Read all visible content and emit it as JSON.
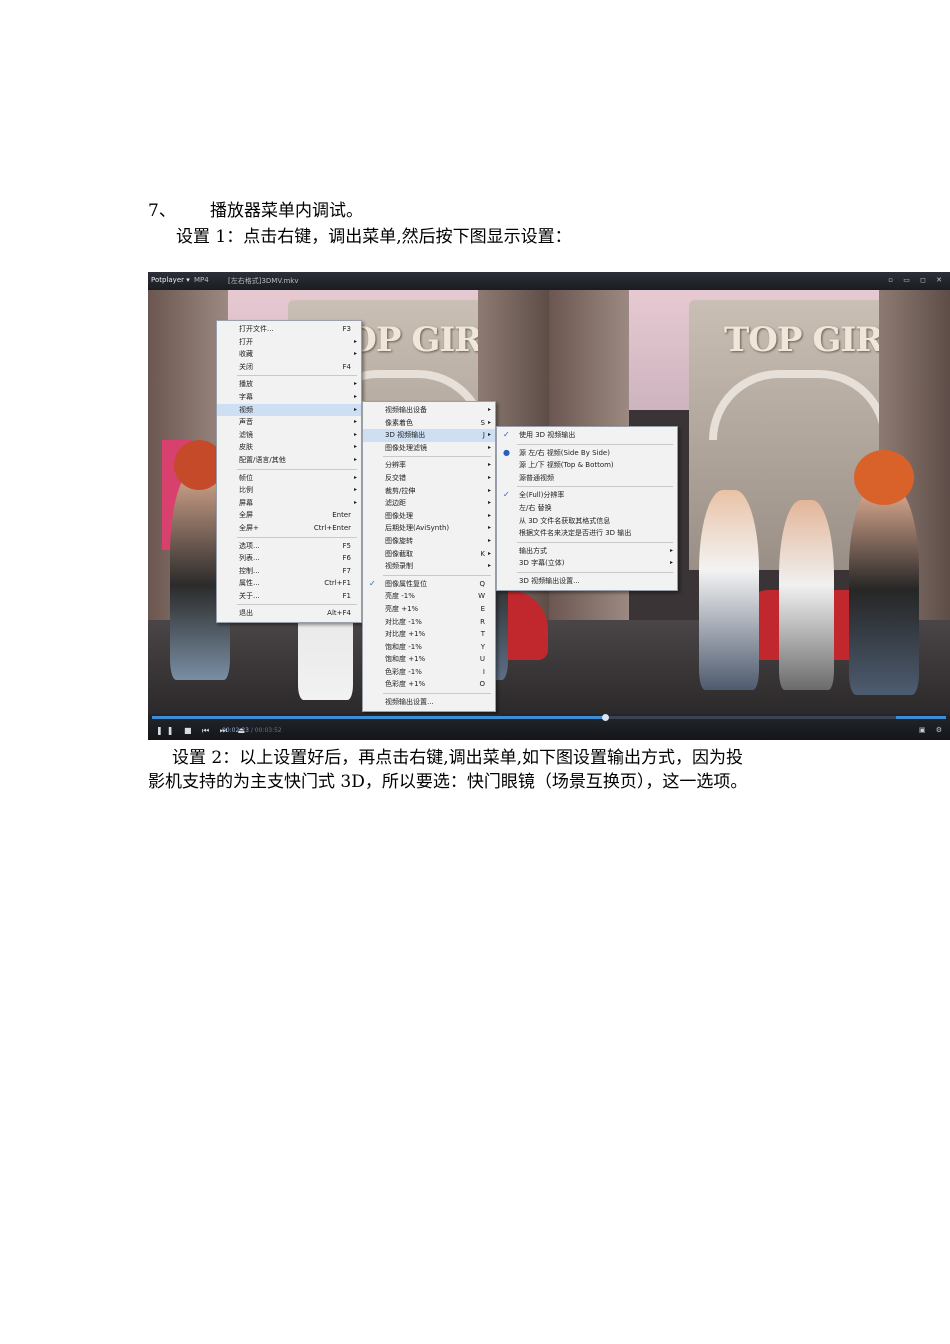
{
  "doc": {
    "step_number": "7、",
    "step_title": "播放器菜单内调试。",
    "setting1": "设置 1：点击右键，调出菜单,然后按下图显示设置：",
    "setting2_line1": "设置 2：以上设置好后，再点击右键,调出菜单,如下图设置输出方式，因为投",
    "setting2_line2": "影机支持的为主支快门式 3D，所以要选：快门眼镜（场景互换页），这一选项。"
  },
  "player": {
    "app_name": "Potplayer ▾",
    "format": "MP4",
    "file_name": "[左右格式]3DMV.mkv",
    "window_controls": "▫ ▭ ◻ ✕",
    "sign_text": "TOP GIRL",
    "current_time": "00:02:23",
    "total_time": "/ 00:03:52",
    "progress": 0.57,
    "playback_buttons": "❚❚ ■ ⏮ ⏭ ⏏",
    "right_controls": "▣ ⚙"
  },
  "menu1": [
    {
      "label": "打开文件...",
      "shortcut": "F3"
    },
    {
      "label": "打开",
      "arrow": true
    },
    {
      "label": "收藏",
      "arrow": true
    },
    {
      "label": "关闭",
      "shortcut": "F4"
    },
    {
      "sep": true
    },
    {
      "label": "播放",
      "arrow": true
    },
    {
      "label": "字幕",
      "arrow": true
    },
    {
      "label": "视频",
      "arrow": true,
      "highlight": true
    },
    {
      "label": "声音",
      "arrow": true
    },
    {
      "label": "滤镜",
      "arrow": true
    },
    {
      "label": "皮肤",
      "arrow": true
    },
    {
      "label": "配置/语言/其他",
      "arrow": true
    },
    {
      "sep": true
    },
    {
      "label": "帧位",
      "arrow": true
    },
    {
      "label": "比例",
      "arrow": true
    },
    {
      "label": "屏幕",
      "arrow": true
    },
    {
      "label": "全屏",
      "shortcut": "Enter"
    },
    {
      "label": "全屏+",
      "shortcut": "Ctrl+Enter"
    },
    {
      "sep": true
    },
    {
      "label": "选项...",
      "shortcut": "F5"
    },
    {
      "label": "列表...",
      "shortcut": "F6"
    },
    {
      "label": "控制...",
      "shortcut": "F7"
    },
    {
      "label": "属性...",
      "shortcut": "Ctrl+F1"
    },
    {
      "label": "关于...",
      "shortcut": "F1"
    },
    {
      "sep": true
    },
    {
      "label": "退出",
      "shortcut": "Alt+F4"
    }
  ],
  "menu2": [
    {
      "label": "视频输出设备",
      "arrow": true
    },
    {
      "label": "像素着色",
      "shortcut": "S",
      "arrow": true
    },
    {
      "label": "3D 视频输出",
      "shortcut": "J",
      "arrow": true,
      "highlight": true
    },
    {
      "label": "图像处理滤镜",
      "arrow": true
    },
    {
      "sep": true
    },
    {
      "label": "分辨率",
      "arrow": true
    },
    {
      "label": "反交错",
      "arrow": true
    },
    {
      "label": "裁剪/拉伸",
      "arrow": true
    },
    {
      "label": "滤边距",
      "arrow": true
    },
    {
      "label": "图像处理",
      "arrow": true
    },
    {
      "label": "后期处理(AviSynth)",
      "arrow": true
    },
    {
      "label": "图像旋转",
      "arrow": true
    },
    {
      "label": "图像截取",
      "shortcut": "K",
      "arrow": true
    },
    {
      "label": "视频录制",
      "arrow": true
    },
    {
      "sep": true
    },
    {
      "label": "图像属性复位",
      "shortcut": "Q",
      "check": "✓"
    },
    {
      "label": "亮度 -1%",
      "shortcut": "W"
    },
    {
      "label": "亮度 +1%",
      "shortcut": "E"
    },
    {
      "label": "对比度 -1%",
      "shortcut": "R"
    },
    {
      "label": "对比度 +1%",
      "shortcut": "T"
    },
    {
      "label": "饱和度 -1%",
      "shortcut": "Y"
    },
    {
      "label": "饱和度 +1%",
      "shortcut": "U"
    },
    {
      "label": "色彩度 -1%",
      "shortcut": "I"
    },
    {
      "label": "色彩度 +1%",
      "shortcut": "O"
    },
    {
      "sep": true
    },
    {
      "label": "视频输出设置..."
    }
  ],
  "menu3": [
    {
      "label": "使用 3D 视频输出",
      "check": "✓"
    },
    {
      "sep": true
    },
    {
      "label": "源 左/右 视频(Side By Side)",
      "check": "●"
    },
    {
      "label": "源 上/下 视频(Top & Bottom)"
    },
    {
      "label": "源普通视频"
    },
    {
      "sep": true
    },
    {
      "label": "全(Full)分辨率",
      "check": "✓"
    },
    {
      "label": "左/右 替换"
    },
    {
      "label": "从 3D 文件名获取其格式信息"
    },
    {
      "label": "根据文件名来决定是否进行 3D 输出"
    },
    {
      "sep": true
    },
    {
      "label": "输出方式",
      "arrow": true
    },
    {
      "label": "3D 字幕(立体)",
      "arrow": true
    },
    {
      "sep": true
    },
    {
      "label": "3D 视频输出设置..."
    }
  ]
}
